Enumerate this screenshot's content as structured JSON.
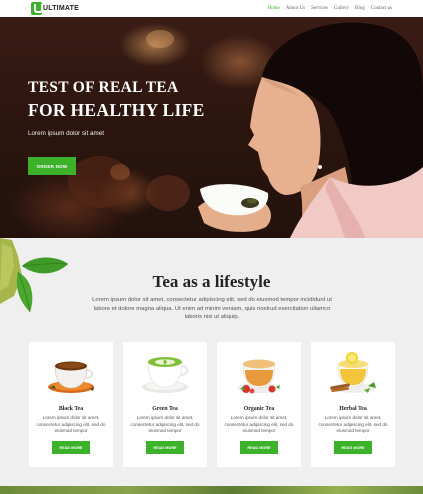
{
  "header": {
    "logo_letter": "U",
    "logo_text": "ULTIMATE",
    "nav": [
      "Home",
      "About Us",
      "Services",
      "Gallery",
      "Blog",
      "Contact us"
    ],
    "active_index": 0
  },
  "hero": {
    "title_line1": "TEST OF REAL TEA",
    "title_line2": "FOR HEALTHY LIFE",
    "subtitle": "Lorem ipsum dolor sit amet",
    "button": "ORDER NOW"
  },
  "intro": {
    "title": "Tea as a lifestyle",
    "text": "Lorem ipsum dolor sit amet, consectetur adipiscing elit, sed do eiusmod tempor incididunt ut labore et dolore magna aliqua. Ut enim ad minim veniam, quis nostrud exercitation ullamco laboris nisi ut aliquip."
  },
  "cards": [
    {
      "title": "Black Tea",
      "text": "Lorem ipsum dolor sit amet, consectetur adipiscing elit, sed do eiusmod tempor",
      "button": "READ MORE",
      "icon": "black-tea-cup-icon"
    },
    {
      "title": "Green Tea",
      "text": "Lorem ipsum dolor sit amet, consectetur adipiscing elit, sed do eiusmod tempor",
      "button": "READ MORE",
      "icon": "green-tea-cup-icon"
    },
    {
      "title": "Organic Tea",
      "text": "Lorem ipsum dolor sit amet, consectetur adipiscing elit, sed do eiusmod tempor",
      "button": "READ MORE",
      "icon": "organic-tea-cup-icon"
    },
    {
      "title": "Herbal Tea",
      "text": "Lorem ipsum dolor sit amet, consectetur adipiscing elit, sed do eiusmod tempor",
      "button": "READ MORE",
      "icon": "herbal-tea-cup-icon"
    }
  ],
  "colors": {
    "accent": "#3cb22a",
    "background": "#efefef",
    "card": "#ffffff",
    "hero_dark": "#2a140e"
  }
}
